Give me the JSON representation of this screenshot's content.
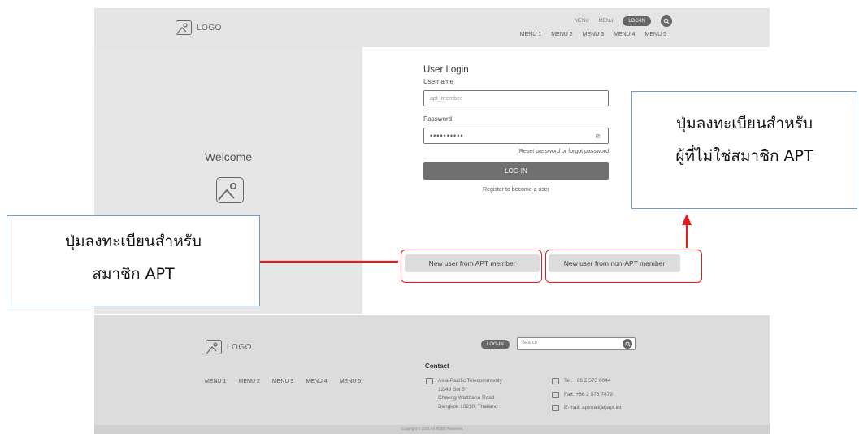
{
  "header": {
    "logo_label": "LOGO",
    "top_links": [
      "MENU",
      "MENU"
    ],
    "login_label": "LOG-IN",
    "menu": [
      "MENU 1",
      "MENU 2",
      "MENU 3",
      "MENU 4",
      "MENU 5"
    ]
  },
  "left_panel": {
    "welcome": "Welcome"
  },
  "form": {
    "title": "User Login",
    "username_label": "Username",
    "username_value": "apt_member",
    "password_label": "Password",
    "password_value": "••••••••••",
    "reset_link": "Reset password or forgot password",
    "login_button": "LOG-IN",
    "register_text": "Register to become a user",
    "btn_apt": "New user from APT member",
    "btn_nonapt": "New user from non-APT member"
  },
  "footer": {
    "logo_label": "LOGO",
    "login_label": "LOG-IN",
    "search_placeholder": "Search",
    "contact_heading": "Contact",
    "menu": [
      "MENU 1",
      "MENU 2",
      "MENU 3",
      "MENU 4",
      "MENU 5"
    ],
    "address": [
      "Asia-Pacific Telecommunity",
      "12/49 Soi 5",
      "Chaeng Watthana Road",
      "Bangkok 10210, Thailand"
    ],
    "tel": "Tel. +66 2 573 0044",
    "fax": "Fax. +66 2 573 7479",
    "email": "E-mail: aptmail(at)apt.int",
    "copyright": "Copyright © 2021 All Rights Reserved"
  },
  "annotations": {
    "right_line1": "ปุ่มลงทะเบียนสำหรับ",
    "right_line2": "ผู้ที่ไม่ใช่สมาชิก APT",
    "left_line1": "ปุ่มลงทะเบียนสำหรับ",
    "left_line2": "สมาชิก APT",
    "highlight_color": "#e21b1b",
    "callout_border": "#6e9bc8"
  }
}
